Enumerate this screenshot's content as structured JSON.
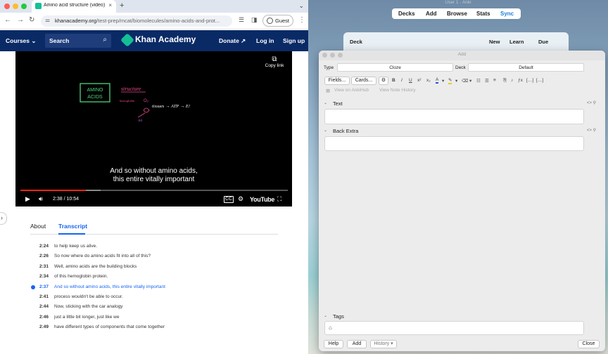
{
  "browser": {
    "tab_title": "Amino acid structure (video) | Khan Academy",
    "tab_close": "×",
    "new_tab": "+",
    "url_host": "khanacademy.org",
    "url_path": "/test-prep/mcat/biomolecules/amino-acids-and-prot...",
    "profile_label": "Guest"
  },
  "ka": {
    "courses_label": "Courses",
    "search_label": "Search",
    "brand": "Khan Academy",
    "donate_label": "Donate",
    "login_label": "Log in",
    "signup_label": "Sign up"
  },
  "video": {
    "copy_link_label": "Copy link",
    "board_box": "AMINO ACIDS",
    "board_structure": "structure",
    "board_hemoglobin": "hemoglobin",
    "board_chain": "tissues → ATP → E!",
    "caption_line1": "And so without amino acids,",
    "caption_line2": "this entire vitally important",
    "time_display": "2:38 / 10:54",
    "progress_played": 0.244,
    "progress_buffered": 0.3,
    "brand_logo": "YouTube"
  },
  "content_tabs": {
    "about": "About",
    "transcript": "Transcript"
  },
  "transcript": [
    {
      "time": "2:24",
      "text": "to help keep us alive.",
      "active": false
    },
    {
      "time": "2:26",
      "text": "So now where do amino acids fit into all of this?",
      "active": false
    },
    {
      "time": "2:31",
      "text": "Well, amino acids are the building blocks",
      "active": false
    },
    {
      "time": "2:34",
      "text": "of this hemoglobin protein.",
      "active": false
    },
    {
      "time": "2:37",
      "text": "And so without amino acids, this entire vitally important",
      "active": true
    },
    {
      "time": "2:41",
      "text": "process wouldn't be able to occur.",
      "active": false
    },
    {
      "time": "2:44",
      "text": "Now, sticking with the car analogy",
      "active": false
    },
    {
      "time": "2:46",
      "text": "just a little bit longer, just like we",
      "active": false
    },
    {
      "time": "2:49",
      "text": "have different types of components that come together",
      "active": false
    }
  ],
  "anki": {
    "window_title": "User 1 - Anki",
    "toolbar": [
      "Decks",
      "Add",
      "Browse",
      "Stats",
      "Sync"
    ],
    "deck_header": {
      "deck": "Deck",
      "new": "New",
      "learn": "Learn",
      "due": "Due"
    },
    "add": {
      "window_title": "Add",
      "type_label": "Type",
      "type_value": "Cloze",
      "deck_label": "Deck",
      "deck_value": "Default",
      "fields_btn": "Fields...",
      "cards_btn": "Cards...",
      "view_ankihub": "View on AnkiHub",
      "view_history": "View Note History",
      "field1": "Text",
      "field2": "Back Extra",
      "field_icons": "<> ⚲",
      "tags_label": "Tags",
      "help_btn": "Help",
      "add_btn": "Add",
      "history_btn": "History ▾",
      "close_btn": "Close"
    }
  },
  "colors": {
    "ka_navy": "#0a2a66",
    "ka_blue": "#1865f2",
    "ka_green": "#14bf96",
    "anki_sync": "#1a7dd8"
  }
}
